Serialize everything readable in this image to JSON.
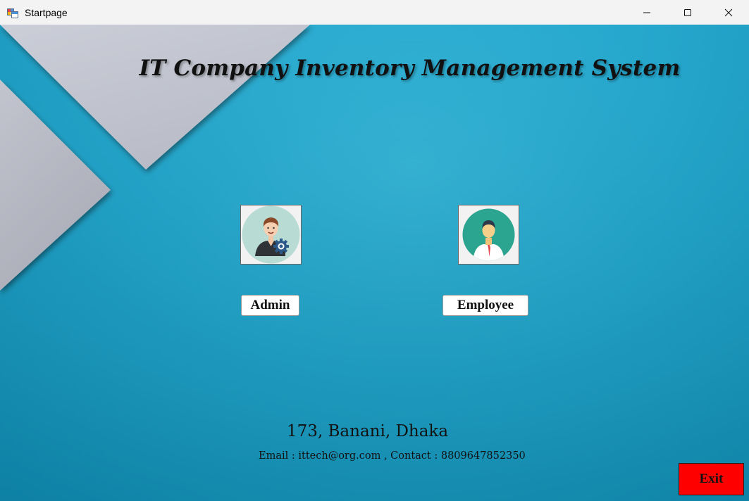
{
  "window": {
    "title": "Startpage",
    "icon": "windows-forms-app-icon",
    "controls": [
      "minimize-icon",
      "maximize-icon",
      "close-icon"
    ]
  },
  "main": {
    "heading": "IT Company Inventory Management System",
    "roles": [
      {
        "label": "Admin",
        "avatar": "admin-user-gear-avatar",
        "avatar_bg": "#b8dcd4"
      },
      {
        "label": "Employee",
        "avatar": "employee-user-avatar",
        "avatar_bg": "#2ba58f"
      }
    ],
    "address": "173, Banani, Dhaka",
    "contact": "Email : ittech@org.com , Contact : 8809647852350",
    "exit_label": "Exit"
  },
  "colors": {
    "background": "#1ea5cc",
    "exit_button": "#ff0000",
    "title_bar": "#f3f3f3"
  }
}
